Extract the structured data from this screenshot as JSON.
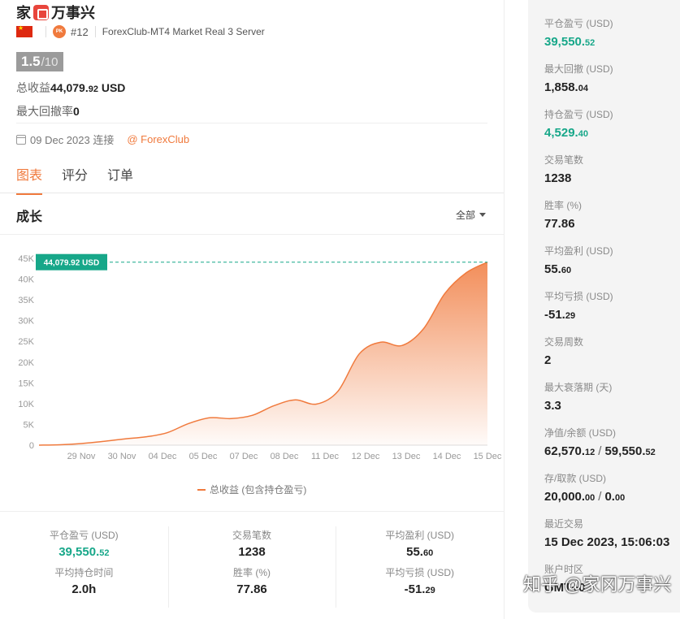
{
  "header": {
    "name_part1": "家",
    "name_part2": "万事兴",
    "rank": "#12",
    "server": "ForexClub-MT4 Market Real 3 Server",
    "pk_label": "PK"
  },
  "score": {
    "value": "1.5",
    "denom": "/10"
  },
  "summary": {
    "profit_label": "总收益",
    "profit_main": "44,079.",
    "profit_dec": "92",
    "profit_unit": " USD",
    "drawdown_label": "最大回撤率",
    "drawdown_value": "0"
  },
  "since": {
    "date": "09 Dec 2023 连接",
    "broker": "@ ForexClub"
  },
  "tabs": [
    "图表",
    "评分",
    "订单"
  ],
  "chart_section": {
    "title": "成长",
    "range": "全部"
  },
  "chart_data": {
    "type": "area",
    "y_ticks": [
      "0",
      "5K",
      "10K",
      "15K",
      "20K",
      "25K",
      "30K",
      "35K",
      "40K",
      "45K"
    ],
    "x_ticks": [
      "29 Nov",
      "30 Nov",
      "04 Dec",
      "05 Dec",
      "07 Dec",
      "08 Dec",
      "11 Dec",
      "12 Dec",
      "13 Dec",
      "14 Dec",
      "15 Dec"
    ],
    "ylim": [
      0,
      45000
    ],
    "series": [
      {
        "name": "总收益 (包含持仓盈亏)",
        "values": [
          0,
          100,
          400,
          900,
          1500,
          2000,
          3000,
          5200,
          6600,
          6400,
          7200,
          9500,
          10900,
          9900,
          13000,
          22000,
          24800,
          24000,
          28000,
          36500,
          41500,
          44079.92
        ]
      }
    ],
    "last_value_label": "44,079.92 USD",
    "color": "#f07a3d"
  },
  "bottom_stats": [
    [
      {
        "label": "平仓盈亏 (USD)",
        "main": "39,550.",
        "dec": "52",
        "green": true
      },
      {
        "label": "平均持仓时间",
        "main": "2.0h",
        "dec": ""
      }
    ],
    [
      {
        "label": "交易笔数",
        "main": "1238",
        "dec": ""
      },
      {
        "label": "胜率 (%)",
        "main": "77.86",
        "dec": ""
      }
    ],
    [
      {
        "label": "平均盈利 (USD)",
        "main": "55.",
        "dec": "60"
      },
      {
        "label": "平均亏损 (USD)",
        "main": "-51.",
        "dec": "29"
      }
    ]
  ],
  "sidebar": [
    {
      "label": "平仓盈亏 (USD)",
      "main": "39,550.",
      "dec": "52",
      "green": true
    },
    {
      "label": "最大回撤 (USD)",
      "main": "1,858.",
      "dec": "04"
    },
    {
      "label": "持仓盈亏 (USD)",
      "main": "4,529.",
      "dec": "40",
      "green": true
    },
    {
      "label": "交易笔数",
      "main": "1238",
      "dec": ""
    },
    {
      "label": "胜率 (%)",
      "main": "77.86",
      "dec": ""
    },
    {
      "label": "平均盈利 (USD)",
      "main": "55.",
      "dec": "60"
    },
    {
      "label": "平均亏损 (USD)",
      "main": "-51.",
      "dec": "29"
    },
    {
      "label": "交易周数",
      "main": "2",
      "dec": ""
    },
    {
      "label": "最大衰落期 (天)",
      "main": "3.3",
      "dec": ""
    },
    {
      "label": "净值/余额 (USD)",
      "main": "62,570.",
      "dec": "12",
      "main2": "59,550.",
      "dec2": "52"
    },
    {
      "label": "存/取款 (USD)",
      "main": "20,000.",
      "dec": "00",
      "main2": "0.",
      "dec2": "00"
    },
    {
      "label": "最近交易",
      "main": "15 Dec 2023, 15:06:03",
      "dec": ""
    },
    {
      "label": "账户时区",
      "main": "GMT+0",
      "dec": ""
    }
  ],
  "watermark": "知乎 @家冈万事兴"
}
